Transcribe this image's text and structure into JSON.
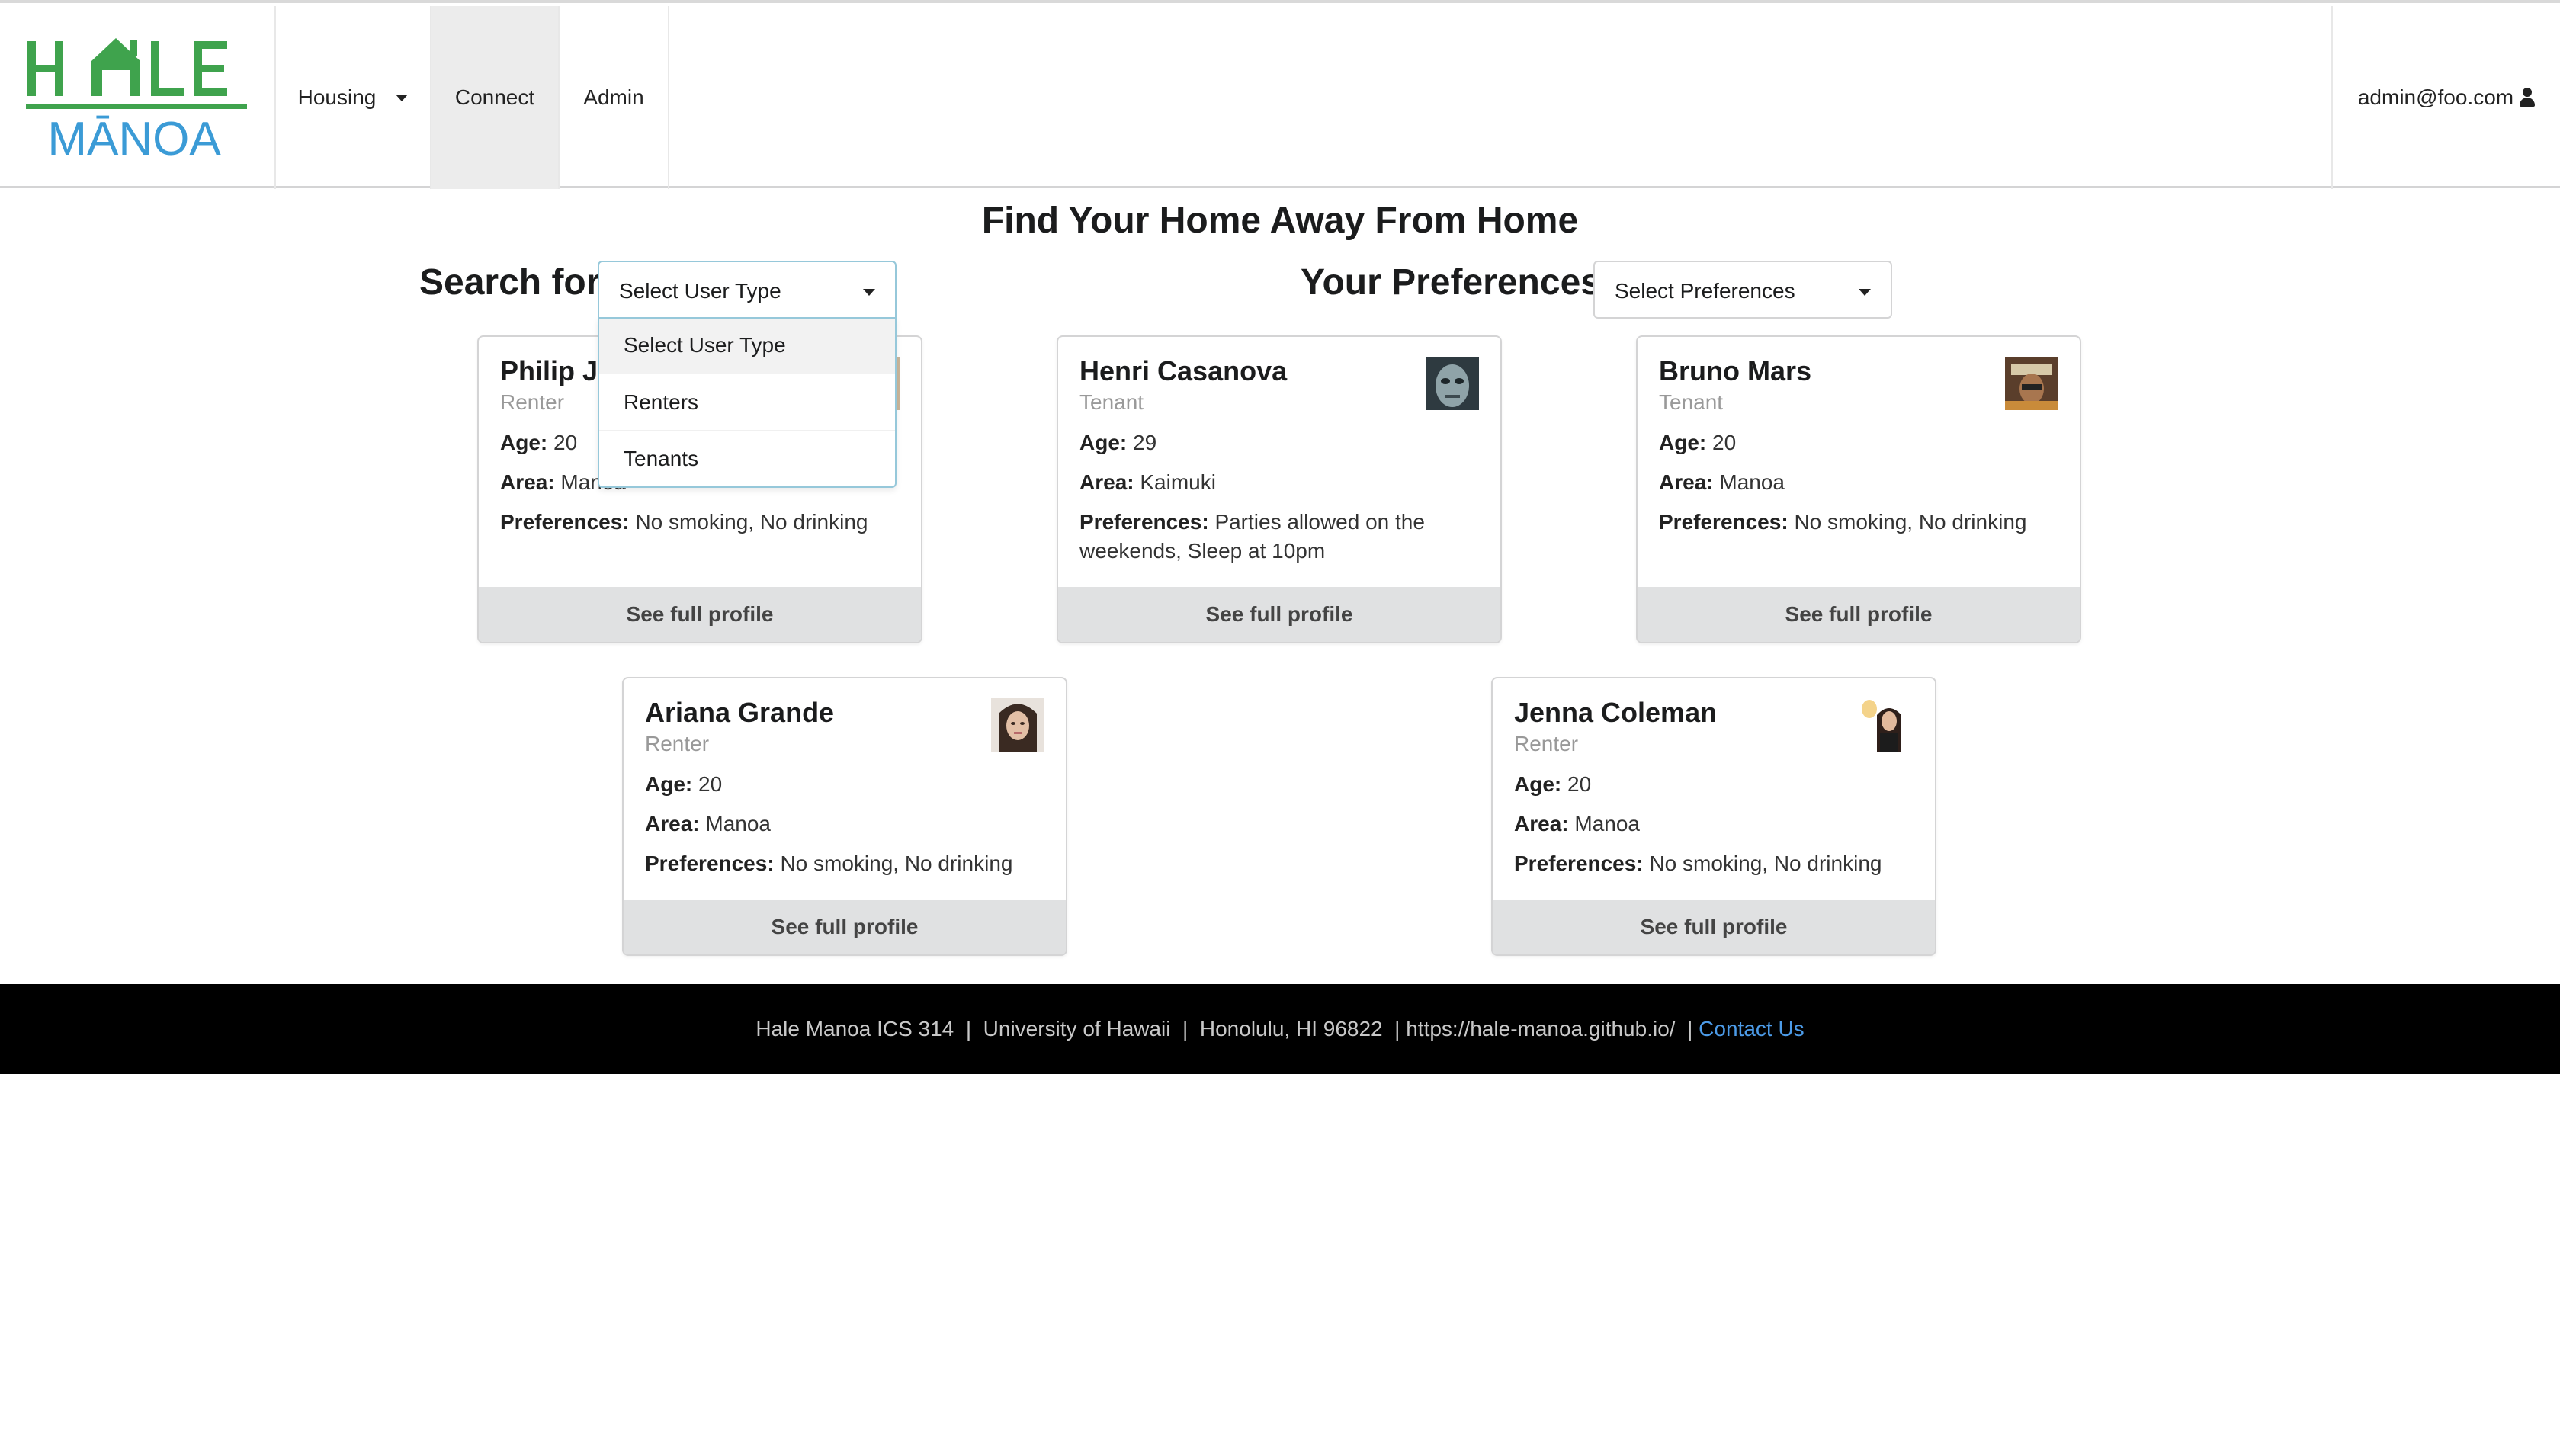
{
  "brand": {
    "logo_top": "HALE",
    "logo_bottom": "MĀNOA",
    "green": "#3fa34d",
    "blue": "#3b9bd6"
  },
  "nav": {
    "housing": "Housing",
    "connect": "Connect",
    "admin": "Admin",
    "user_email": "admin@foo.com",
    "user_icon": "user-icon"
  },
  "page": {
    "title": "Find Your Home Away From Home",
    "search_label": "Search for:",
    "preferences_label": "Your Preferences:"
  },
  "user_type_dropdown": {
    "selected": "Select User Type",
    "options": [
      "Select User Type",
      "Renters",
      "Tenants"
    ]
  },
  "preferences_dropdown": {
    "selected": "Select Preferences"
  },
  "cards": [
    {
      "name": "Philip Jo",
      "type": "Renter",
      "age": "20",
      "area": "Manoa",
      "preferences": "No smoking, No drinking",
      "button": "See full profile"
    },
    {
      "name": "Henri Casanova",
      "type": "Tenant",
      "age": "29",
      "area": "Kaimuki",
      "preferences": "Parties allowed on the",
      "preferences_cont": "weekends, Sleep at 10pm",
      "button": "See full profile"
    },
    {
      "name": "Bruno Mars",
      "type": "Tenant",
      "age": "20",
      "area": "Manoa",
      "preferences": "No smoking, No drinking",
      "button": "See full profile"
    },
    {
      "name": "Ariana Grande",
      "type": "Renter",
      "age": "20",
      "area": "Manoa",
      "preferences": "No smoking, No drinking",
      "button": "See full profile"
    },
    {
      "name": "Jenna Coleman",
      "type": "Renter",
      "age": "20",
      "area": "Manoa",
      "preferences": "No smoking, No drinking",
      "button": "See full profile"
    }
  ],
  "labels": {
    "age": "Age:",
    "area": "Area:",
    "preferences": "Preferences:"
  },
  "footer": {
    "text": "Hale Manoa ICS 314  |  University of Hawaii  |  Honolulu, HI 96822  | https://hale-manoa.github.io/  | ",
    "contact": "Contact Us",
    "link_color": "#4c9be8"
  }
}
